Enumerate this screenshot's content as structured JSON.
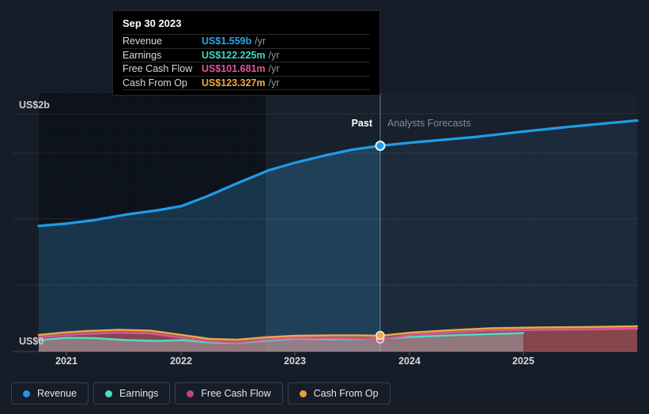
{
  "colors": {
    "background": "#161d28",
    "revenue": "#1f9ce8",
    "earnings": "#57d8c2",
    "free_cash_flow": "#dd5397",
    "cash_from_op": "#eda74a",
    "past_region": "#0c121b",
    "forecast_region": "#161f2b",
    "revenue_area": "#17344b",
    "tooltip_background": "#000000"
  },
  "tooltip": {
    "title": "Sep 30 2023",
    "rows": [
      {
        "label": "Revenue",
        "value": "US$1.559b",
        "unit": "/yr"
      },
      {
        "label": "Earnings",
        "value": "US$122.225m",
        "unit": "/yr"
      },
      {
        "label": "Free Cash Flow",
        "value": "US$101.681m",
        "unit": "/yr"
      },
      {
        "label": "Cash From Op",
        "value": "US$123.327m",
        "unit": "/yr"
      }
    ]
  },
  "axis": {
    "y_top_label": "US$2b",
    "y_bottom_label": "US$0",
    "x_labels": [
      "2021",
      "2022",
      "2023",
      "2024",
      "2025"
    ]
  },
  "annotations": {
    "past_label": "Past",
    "forecast_label": "Analysts Forecasts"
  },
  "legend": {
    "items": [
      {
        "label": "Revenue",
        "color": "#2196e3"
      },
      {
        "label": "Earnings",
        "color": "#4fdcc4"
      },
      {
        "label": "Free Cash Flow",
        "color": "#bc4489"
      },
      {
        "label": "Cash From Op",
        "color": "#e2a33d"
      }
    ]
  },
  "chart_data": {
    "type": "line",
    "title": "Past and forecast financials with tooltip at Sep 30 2023",
    "xlabel": "",
    "ylabel": "US$",
    "x_axis": {
      "tick_labels": [
        "2021",
        "2022",
        "2023",
        "2024",
        "2025"
      ],
      "range_start": "2020-10",
      "range_end": "2025-12"
    },
    "y_axis": {
      "tick_labels": [
        "US$0",
        "US$2b"
      ],
      "min": 0,
      "max": 2200000000
    },
    "grid": true,
    "legend_position": "bottom-left",
    "divider": {
      "date": "2023-09-30",
      "left_label": "Past",
      "right_label": "Analysts Forecasts"
    },
    "highlight_band": {
      "from": "2022-10",
      "to": "2023-09-30"
    },
    "series": [
      {
        "name": "Revenue",
        "unit": "US$ billions",
        "forecast_from": "2023-09-30",
        "x": [
          "2020-10",
          "2021-01",
          "2021-07",
          "2022-01",
          "2022-07",
          "2023-01",
          "2023-09-30",
          "2024-01",
          "2024-07",
          "2025-01",
          "2025-12"
        ],
        "values": [
          0.96,
          0.97,
          1.02,
          1.09,
          1.27,
          1.43,
          1.559,
          1.58,
          1.62,
          1.67,
          1.74
        ]
      },
      {
        "name": "Earnings",
        "unit": "US$ millions",
        "forecast_from": "2023-09-30",
        "forecast_until": "2025-01",
        "x": [
          "2020-10",
          "2021-01",
          "2021-07",
          "2022-01",
          "2022-04",
          "2022-10",
          "2023-01",
          "2023-09-30",
          "2024-01",
          "2024-07",
          "2025-01"
        ],
        "values": [
          87,
          105,
          90,
          87,
          68,
          66,
          99,
          122.225,
          111,
          120,
          130
        ]
      },
      {
        "name": "Free Cash Flow",
        "unit": "US$ millions",
        "forecast_from": "2023-09-30",
        "x": [
          "2020-10",
          "2021-01",
          "2021-07",
          "2022-01",
          "2022-04",
          "2022-10",
          "2023-01",
          "2023-09-30",
          "2024-01",
          "2024-07",
          "2025-01",
          "2025-12"
        ],
        "values": [
          108,
          123,
          144,
          105,
          78,
          69,
          105,
          101.681,
          123,
          141,
          153,
          171
        ]
      },
      {
        "name": "Cash From Op",
        "unit": "US$ millions",
        "forecast_from": "2023-09-30",
        "x": [
          "2020-10",
          "2021-01",
          "2021-07",
          "2022-01",
          "2022-04",
          "2022-10",
          "2023-01",
          "2023-09-30",
          "2024-01",
          "2024-07",
          "2025-01",
          "2025-12"
        ],
        "values": [
          126,
          144,
          165,
          126,
          96,
          90,
          120,
          123.327,
          141,
          159,
          171,
          192
        ]
      }
    ]
  }
}
